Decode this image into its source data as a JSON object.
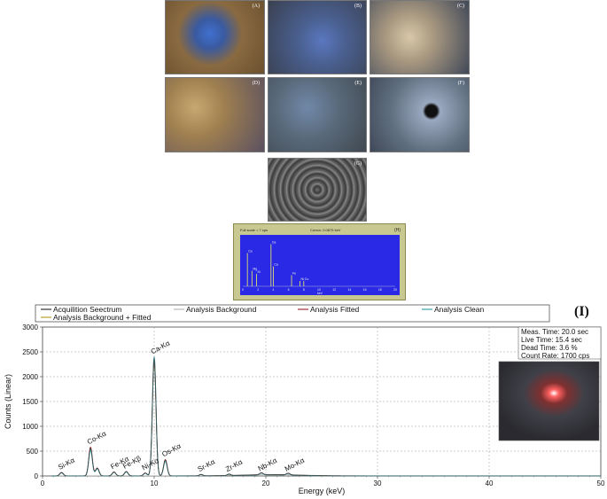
{
  "panels": [
    {
      "label": "(A)"
    },
    {
      "label": "(B)"
    },
    {
      "label": "(C)"
    },
    {
      "label": "(D)"
    },
    {
      "label": "(E)"
    },
    {
      "label": "(F)"
    },
    {
      "label": "(G)"
    }
  ],
  "eds_inset": {
    "label": "(H)",
    "full_scale": "Full scale = 7   cps",
    "cursor": "Cursor: 0.0875 keV",
    "xticks": [
      "0",
      "2",
      "4",
      "6",
      "8",
      "10",
      "12",
      "14",
      "16",
      "18",
      "20"
    ],
    "unit": "keV",
    "peaks": [
      {
        "x": 0.6,
        "h": 0.75,
        "label": "Ca"
      },
      {
        "x": 1.2,
        "h": 0.35,
        "label": "Mg"
      },
      {
        "x": 1.8,
        "h": 0.28,
        "label": "Si"
      },
      {
        "x": 3.7,
        "h": 0.95,
        "label": "Ca"
      },
      {
        "x": 4.0,
        "h": 0.45,
        "label": "Ca"
      },
      {
        "x": 6.4,
        "h": 0.25,
        "label": "Fe"
      },
      {
        "x": 7.5,
        "h": 0.12,
        "label": "Ni"
      },
      {
        "x": 8.0,
        "h": 0.12,
        "label": "Cu"
      }
    ]
  },
  "figure_label": "(I)",
  "chart_data": {
    "type": "line",
    "xlabel": "Energy (keV)",
    "ylabel": "Counts (Linear)",
    "xlim": [
      0,
      50
    ],
    "ylim": [
      0,
      3000
    ],
    "xticks": [
      0,
      10,
      20,
      30,
      40,
      50
    ],
    "yticks": [
      0,
      500,
      1000,
      1500,
      2000,
      2500,
      3000
    ],
    "grid": true,
    "legend_placement": "top",
    "series": [
      {
        "name": "Acquilition Seectrum",
        "color": "#333333"
      },
      {
        "name": "Analysis Background",
        "color": "#b8b8b8"
      },
      {
        "name": "Analysis Fitted",
        "color": "#a0303a"
      },
      {
        "name": "Analysis Clean",
        "color": "#3aa0a8"
      },
      {
        "name": "Analysis Background + Fitted",
        "color": "#b8a030"
      }
    ],
    "peaks": [
      {
        "energy": 1.7,
        "counts": 70,
        "label": "Si-Kα"
      },
      {
        "energy": 4.3,
        "counts": 580,
        "label": "Co-Kα"
      },
      {
        "energy": 4.9,
        "counts": 160,
        "label": ""
      },
      {
        "energy": 6.4,
        "counts": 80,
        "label": "Fe-Kα"
      },
      {
        "energy": 7.5,
        "counts": 90,
        "label": "Fe-Kβ"
      },
      {
        "energy": 9.2,
        "counts": 60,
        "label": "Ni-Kα"
      },
      {
        "energy": 10.0,
        "counts": 2400,
        "label": "Ca-Kα"
      },
      {
        "energy": 11.0,
        "counts": 330,
        "label": "Os-Kα"
      },
      {
        "energy": 14.2,
        "counts": 30,
        "label": "Sr-Kα"
      },
      {
        "energy": 16.7,
        "counts": 30,
        "label": "Zr-Kα"
      },
      {
        "energy": 19.6,
        "counts": 40,
        "label": "Nb-Kα"
      },
      {
        "energy": 22.0,
        "counts": 35,
        "label": "Mo-Kα"
      }
    ],
    "annotations": [
      "Meas. Time: 20.0 sec",
      "Live Time: 15.4 sec",
      "Dead Time: 3.6 %",
      "Count Rate: 1700 cps"
    ]
  }
}
